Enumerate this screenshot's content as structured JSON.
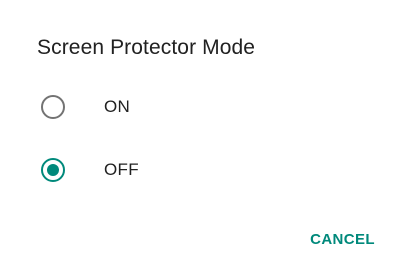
{
  "dialog": {
    "title": "Screen Protector Mode",
    "options": [
      {
        "label": "ON",
        "selected": false
      },
      {
        "label": "OFF",
        "selected": true
      }
    ],
    "cancel_label": "CANCEL"
  },
  "colors": {
    "accent": "#00897b",
    "radio_unchecked": "#737373",
    "text": "#212121"
  }
}
